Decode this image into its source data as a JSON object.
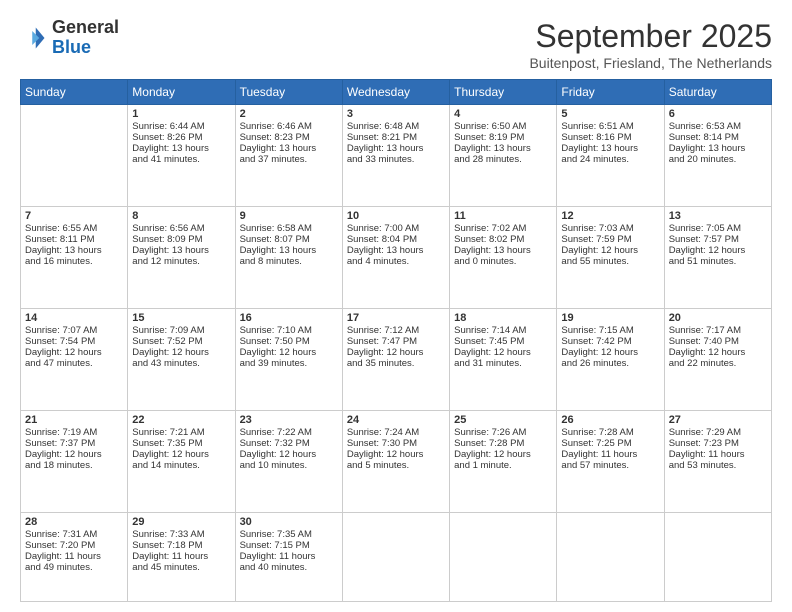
{
  "logo": {
    "general": "General",
    "blue": "Blue"
  },
  "header": {
    "month": "September 2025",
    "location": "Buitenpost, Friesland, The Netherlands"
  },
  "weekdays": [
    "Sunday",
    "Monday",
    "Tuesday",
    "Wednesday",
    "Thursday",
    "Friday",
    "Saturday"
  ],
  "weeks": [
    [
      {
        "day": "",
        "info": ""
      },
      {
        "day": "1",
        "info": "Sunrise: 6:44 AM\nSunset: 8:26 PM\nDaylight: 13 hours\nand 41 minutes."
      },
      {
        "day": "2",
        "info": "Sunrise: 6:46 AM\nSunset: 8:23 PM\nDaylight: 13 hours\nand 37 minutes."
      },
      {
        "day": "3",
        "info": "Sunrise: 6:48 AM\nSunset: 8:21 PM\nDaylight: 13 hours\nand 33 minutes."
      },
      {
        "day": "4",
        "info": "Sunrise: 6:50 AM\nSunset: 8:19 PM\nDaylight: 13 hours\nand 28 minutes."
      },
      {
        "day": "5",
        "info": "Sunrise: 6:51 AM\nSunset: 8:16 PM\nDaylight: 13 hours\nand 24 minutes."
      },
      {
        "day": "6",
        "info": "Sunrise: 6:53 AM\nSunset: 8:14 PM\nDaylight: 13 hours\nand 20 minutes."
      }
    ],
    [
      {
        "day": "7",
        "info": "Sunrise: 6:55 AM\nSunset: 8:11 PM\nDaylight: 13 hours\nand 16 minutes."
      },
      {
        "day": "8",
        "info": "Sunrise: 6:56 AM\nSunset: 8:09 PM\nDaylight: 13 hours\nand 12 minutes."
      },
      {
        "day": "9",
        "info": "Sunrise: 6:58 AM\nSunset: 8:07 PM\nDaylight: 13 hours\nand 8 minutes."
      },
      {
        "day": "10",
        "info": "Sunrise: 7:00 AM\nSunset: 8:04 PM\nDaylight: 13 hours\nand 4 minutes."
      },
      {
        "day": "11",
        "info": "Sunrise: 7:02 AM\nSunset: 8:02 PM\nDaylight: 13 hours\nand 0 minutes."
      },
      {
        "day": "12",
        "info": "Sunrise: 7:03 AM\nSunset: 7:59 PM\nDaylight: 12 hours\nand 55 minutes."
      },
      {
        "day": "13",
        "info": "Sunrise: 7:05 AM\nSunset: 7:57 PM\nDaylight: 12 hours\nand 51 minutes."
      }
    ],
    [
      {
        "day": "14",
        "info": "Sunrise: 7:07 AM\nSunset: 7:54 PM\nDaylight: 12 hours\nand 47 minutes."
      },
      {
        "day": "15",
        "info": "Sunrise: 7:09 AM\nSunset: 7:52 PM\nDaylight: 12 hours\nand 43 minutes."
      },
      {
        "day": "16",
        "info": "Sunrise: 7:10 AM\nSunset: 7:50 PM\nDaylight: 12 hours\nand 39 minutes."
      },
      {
        "day": "17",
        "info": "Sunrise: 7:12 AM\nSunset: 7:47 PM\nDaylight: 12 hours\nand 35 minutes."
      },
      {
        "day": "18",
        "info": "Sunrise: 7:14 AM\nSunset: 7:45 PM\nDaylight: 12 hours\nand 31 minutes."
      },
      {
        "day": "19",
        "info": "Sunrise: 7:15 AM\nSunset: 7:42 PM\nDaylight: 12 hours\nand 26 minutes."
      },
      {
        "day": "20",
        "info": "Sunrise: 7:17 AM\nSunset: 7:40 PM\nDaylight: 12 hours\nand 22 minutes."
      }
    ],
    [
      {
        "day": "21",
        "info": "Sunrise: 7:19 AM\nSunset: 7:37 PM\nDaylight: 12 hours\nand 18 minutes."
      },
      {
        "day": "22",
        "info": "Sunrise: 7:21 AM\nSunset: 7:35 PM\nDaylight: 12 hours\nand 14 minutes."
      },
      {
        "day": "23",
        "info": "Sunrise: 7:22 AM\nSunset: 7:32 PM\nDaylight: 12 hours\nand 10 minutes."
      },
      {
        "day": "24",
        "info": "Sunrise: 7:24 AM\nSunset: 7:30 PM\nDaylight: 12 hours\nand 5 minutes."
      },
      {
        "day": "25",
        "info": "Sunrise: 7:26 AM\nSunset: 7:28 PM\nDaylight: 12 hours\nand 1 minute."
      },
      {
        "day": "26",
        "info": "Sunrise: 7:28 AM\nSunset: 7:25 PM\nDaylight: 11 hours\nand 57 minutes."
      },
      {
        "day": "27",
        "info": "Sunrise: 7:29 AM\nSunset: 7:23 PM\nDaylight: 11 hours\nand 53 minutes."
      }
    ],
    [
      {
        "day": "28",
        "info": "Sunrise: 7:31 AM\nSunset: 7:20 PM\nDaylight: 11 hours\nand 49 minutes."
      },
      {
        "day": "29",
        "info": "Sunrise: 7:33 AM\nSunset: 7:18 PM\nDaylight: 11 hours\nand 45 minutes."
      },
      {
        "day": "30",
        "info": "Sunrise: 7:35 AM\nSunset: 7:15 PM\nDaylight: 11 hours\nand 40 minutes."
      },
      {
        "day": "",
        "info": ""
      },
      {
        "day": "",
        "info": ""
      },
      {
        "day": "",
        "info": ""
      },
      {
        "day": "",
        "info": ""
      }
    ]
  ]
}
